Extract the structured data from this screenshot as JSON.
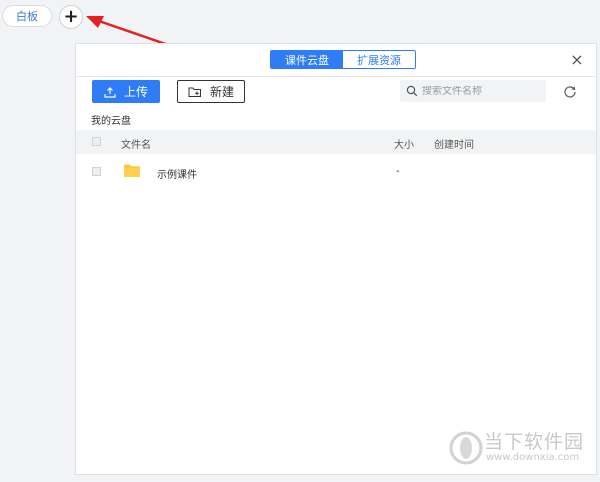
{
  "top_tabs": {
    "whiteboard_label": "白板",
    "add_label": "+"
  },
  "panel": {
    "segments": {
      "cloud": "课件云盘",
      "resources": "扩展资源"
    },
    "close_label": "×",
    "toolbar": {
      "upload_label": "上传",
      "new_label": "新建",
      "search_placeholder": "搜索文件名称"
    },
    "breadcrumb": "我的云盘",
    "table": {
      "headers": {
        "name": "文件名",
        "size": "大小",
        "created": "创建时间"
      },
      "rows": [
        {
          "name": "示例课件",
          "size": "-",
          "created": ""
        }
      ]
    }
  },
  "watermark": {
    "title": "当下软件园",
    "url": "www.downxia.com"
  },
  "colors": {
    "accent": "#2e7cf6",
    "arrow": "#e62020",
    "folder": "#ffc53d"
  }
}
